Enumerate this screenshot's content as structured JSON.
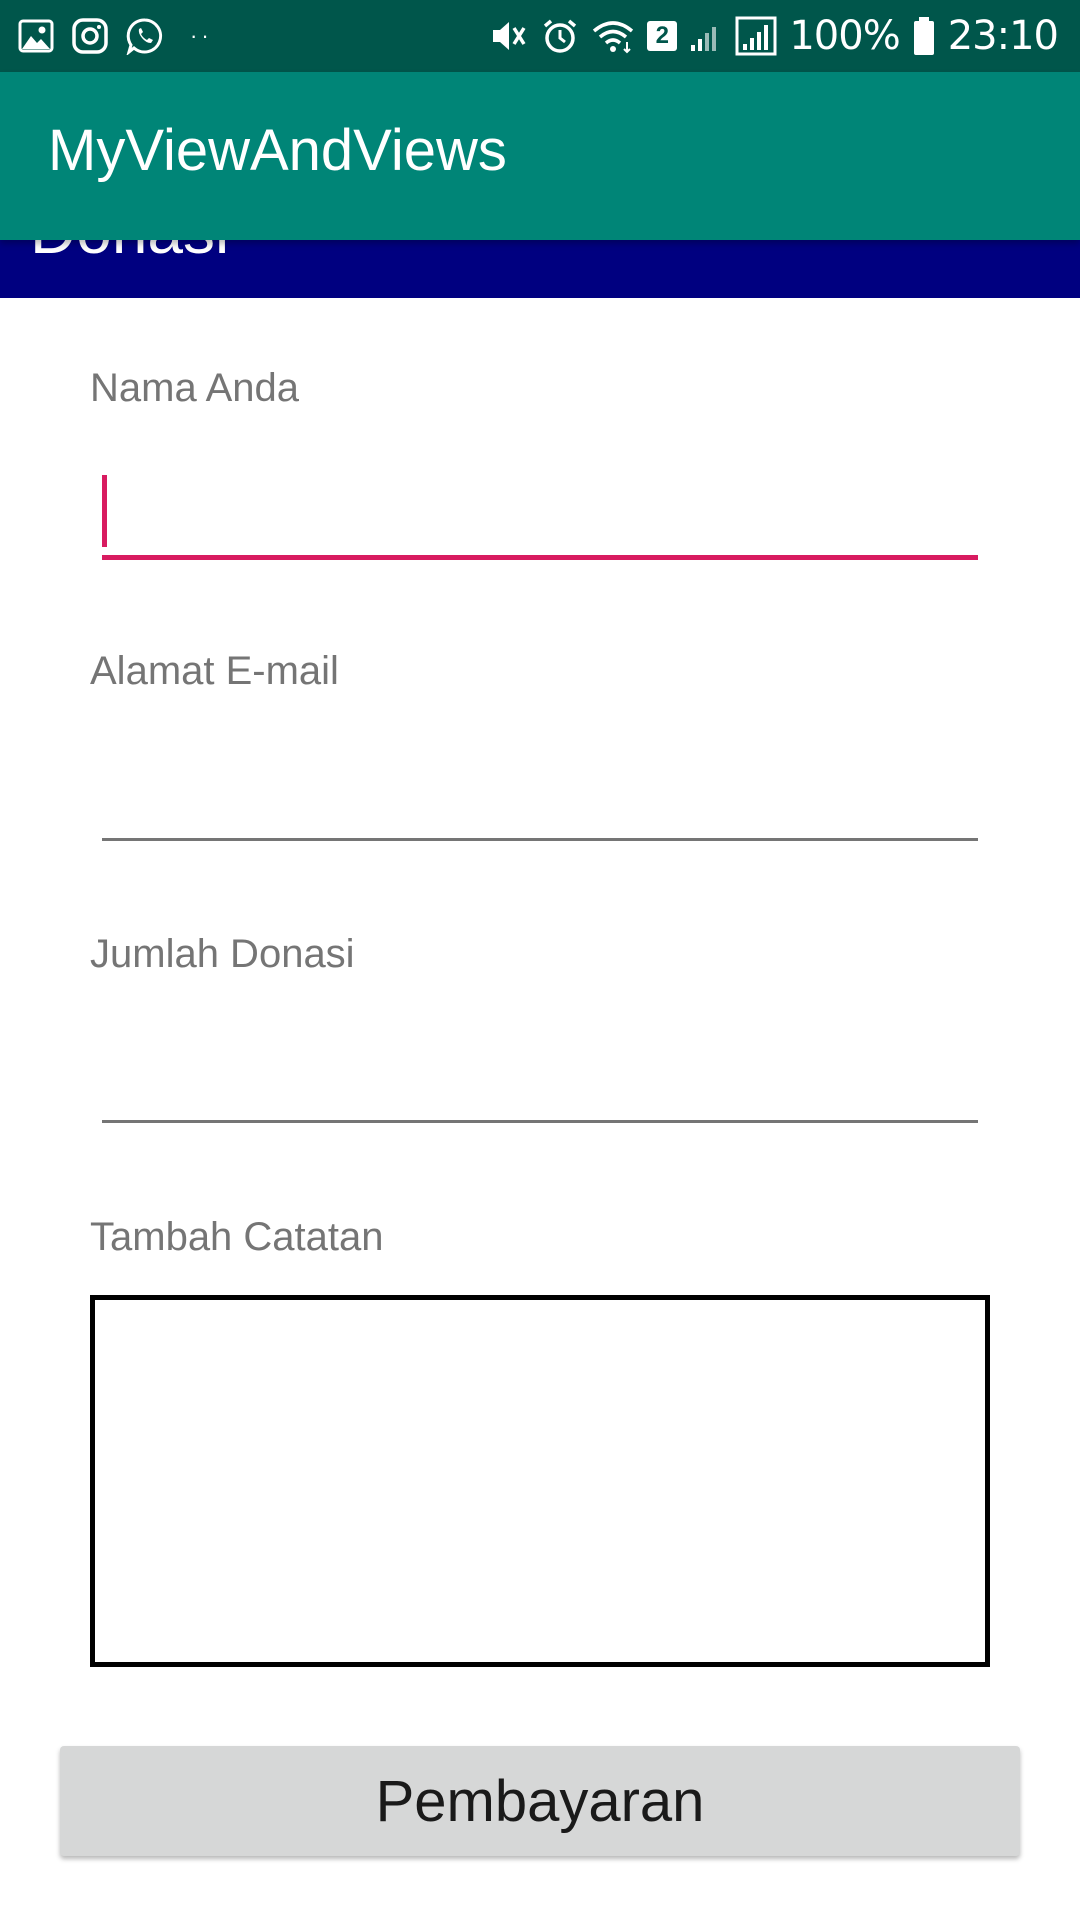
{
  "status_bar": {
    "left_icons": [
      "gallery-icon",
      "instagram-icon",
      "whatsapp-icon"
    ],
    "more_indicator": "··",
    "sim_badge": "2",
    "battery_percent": "100%",
    "time": "23:10"
  },
  "action_bar": {
    "title": "MyViewAndViews",
    "color": "#008577"
  },
  "header_strip": {
    "text": "Donasi",
    "color": "#000080"
  },
  "form": {
    "name_label": "Nama Anda",
    "name_value": "",
    "email_label": "Alamat E-mail",
    "email_value": "",
    "amount_label": "Jumlah Donasi",
    "amount_value": "",
    "notes_label": "Tambah Catatan",
    "notes_value": "",
    "accent_color": "#d81b60"
  },
  "pay_button": {
    "label": "Pembayaran"
  }
}
